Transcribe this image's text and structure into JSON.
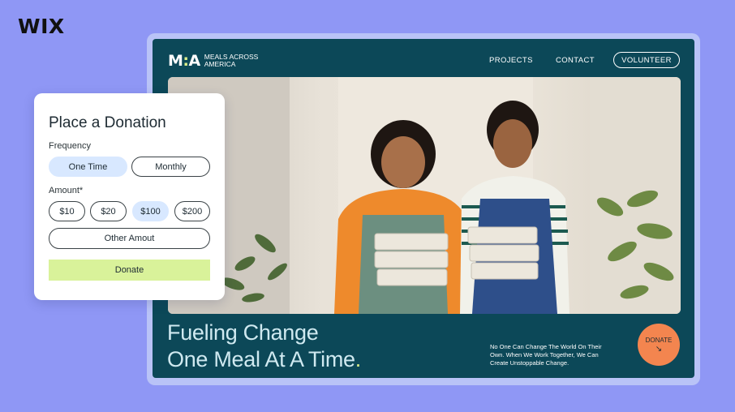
{
  "brand": {
    "logo": "WIX"
  },
  "site": {
    "logo_mark_left": "M",
    "logo_mark_dot": ":",
    "logo_mark_right": "A",
    "logo_name": "MEALS ACROSS AMERICA",
    "nav": {
      "projects": "PROJECTS",
      "contact": "CONTACT",
      "volunteer": "VOLUNTEER"
    },
    "hero": {
      "title_line1": "Fueling Change",
      "title_line2": "One Meal At A Time",
      "title_dot": ".",
      "subtitle": "No One Can Change The World On Their Own. When We Work Together, We Can Create Unstoppable Change.",
      "donate_label": "DONATE",
      "donate_arrow": "↘"
    }
  },
  "donation_card": {
    "title": "Place a Donation",
    "frequency_label": "Frequency",
    "frequency_options": [
      "One Time",
      "Monthly"
    ],
    "frequency_selected": "One Time",
    "amount_label": "Amount*",
    "amount_options": [
      "$10",
      "$20",
      "$100",
      "$200"
    ],
    "amount_selected": "$100",
    "other_amount": "Other Amout",
    "donate_button": "Donate"
  },
  "colors": {
    "background": "#8f97f5",
    "site_bg": "#0c4858",
    "accent_lime": "#dcef8a",
    "donate_orange": "#f3854f",
    "selected_pill": "#d8e8ff",
    "donate_button": "#d9f29a"
  }
}
